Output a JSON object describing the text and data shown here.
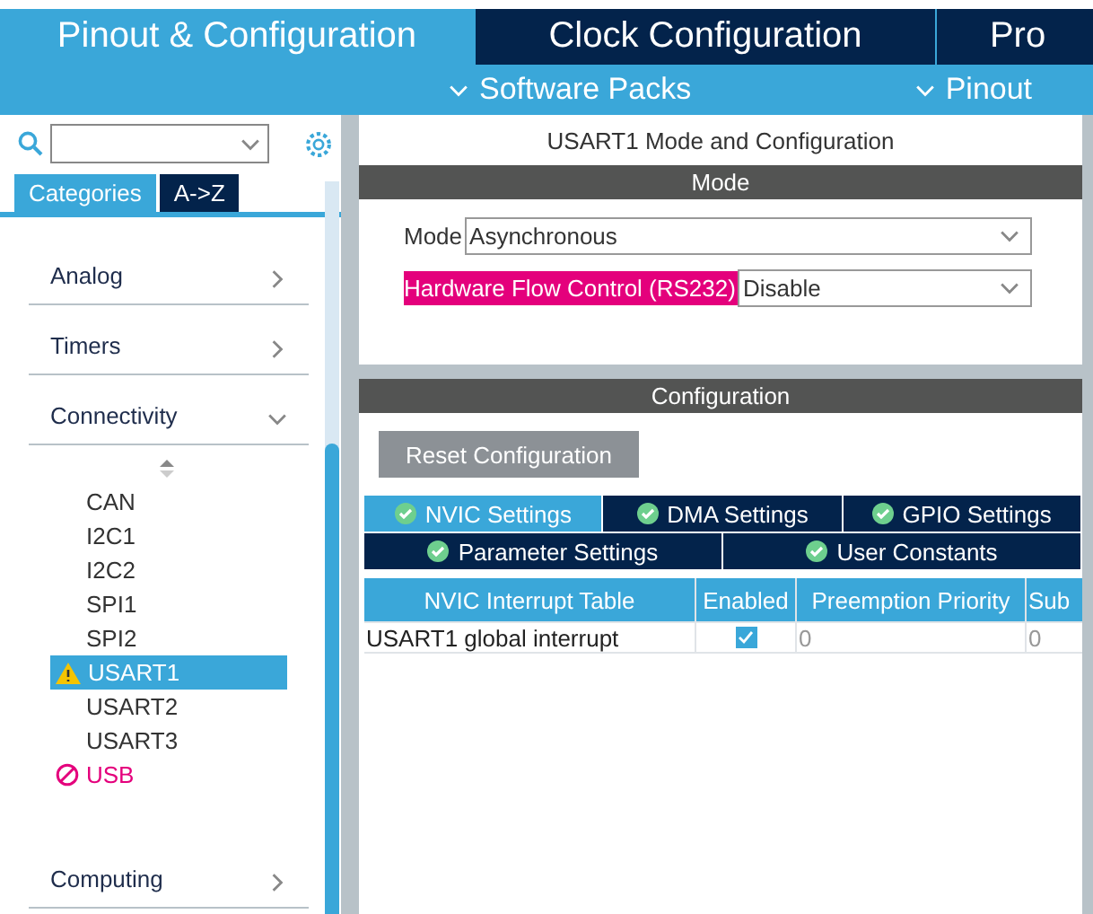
{
  "top_tabs": [
    {
      "label": "Pinout & Configuration",
      "selected": true
    },
    {
      "label": "Clock Configuration",
      "selected": false
    },
    {
      "label": "Pro",
      "selected": false
    }
  ],
  "sub_menu": [
    "Software Packs",
    "Pinout"
  ],
  "sidebar": {
    "view_tabs": [
      {
        "label": "Categories",
        "selected": true
      },
      {
        "label": "A->Z",
        "selected": false
      }
    ],
    "categories": [
      {
        "label": "Analog",
        "expanded": false
      },
      {
        "label": "Timers",
        "expanded": false
      },
      {
        "label": "Connectivity",
        "expanded": true,
        "children": [
          {
            "label": "CAN",
            "kind": "plain",
            "selected": false
          },
          {
            "label": "I2C1",
            "kind": "plain",
            "selected": false
          },
          {
            "label": "I2C2",
            "kind": "plain",
            "selected": false
          },
          {
            "label": "SPI1",
            "kind": "plain",
            "selected": false
          },
          {
            "label": "SPI2",
            "kind": "plain",
            "selected": false
          },
          {
            "label": "USART1",
            "kind": "warning",
            "selected": true
          },
          {
            "label": "USART2",
            "kind": "plain",
            "selected": false
          },
          {
            "label": "USART3",
            "kind": "plain",
            "selected": false
          },
          {
            "label": "USB",
            "kind": "error",
            "selected": false
          }
        ]
      },
      {
        "label": "Computing",
        "expanded": false
      }
    ]
  },
  "panel": {
    "title": "USART1 Mode and Configuration",
    "mode_section": {
      "title": "Mode",
      "fields": [
        {
          "label": "Mode",
          "value": "Asynchronous",
          "highlighted": false
        },
        {
          "label": "Hardware Flow Control (RS232)",
          "value": "Disable",
          "highlighted": true
        }
      ]
    },
    "config_section": {
      "title": "Configuration",
      "reset_button": "Reset Configuration",
      "tab_rows": [
        [
          {
            "label": "NVIC Settings",
            "selected": true
          },
          {
            "label": "DMA Settings",
            "selected": false
          },
          {
            "label": "GPIO Settings",
            "selected": false
          }
        ],
        [
          {
            "label": "Parameter Settings",
            "selected": false
          },
          {
            "label": "User Constants",
            "selected": false
          }
        ]
      ],
      "table": {
        "columns": [
          "NVIC Interrupt Table",
          "Enabled",
          "Preemption Priority",
          "Sub"
        ],
        "rows": [
          {
            "name": "USART1 global interrupt",
            "enabled": true,
            "preemption": "0",
            "sub": "0"
          }
        ]
      }
    }
  }
}
